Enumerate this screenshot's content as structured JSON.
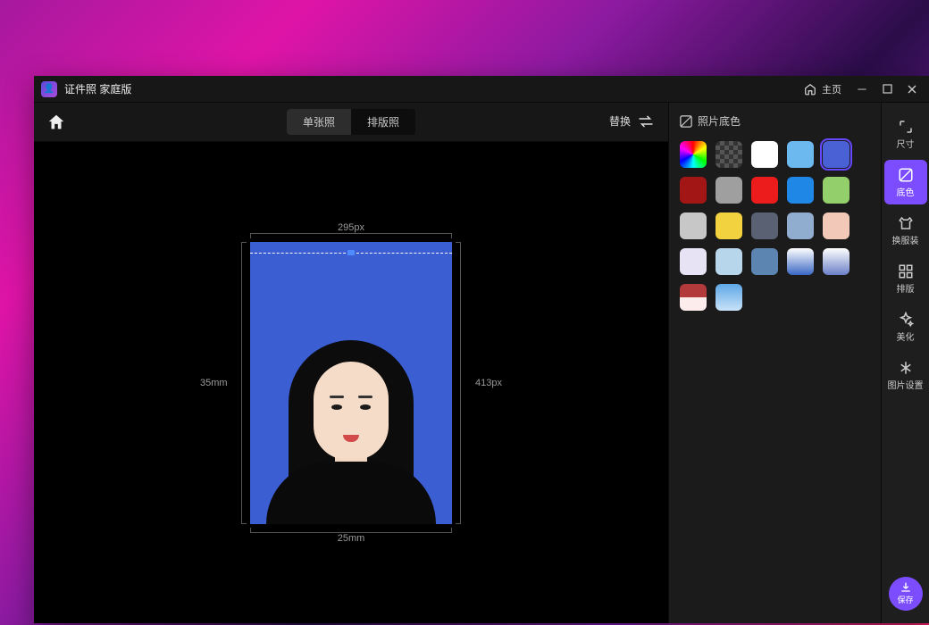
{
  "titlebar": {
    "app_name": "证件照 家庭版",
    "home_label": "主页"
  },
  "toolbar": {
    "tab_single": "单张照",
    "tab_layout": "排版照",
    "replace_label": "替换"
  },
  "canvas": {
    "width_px_label": "295px",
    "height_px_label": "413px",
    "width_mm_label": "25mm",
    "height_mm_label": "35mm",
    "photo_bg_color": "#3b5ed3"
  },
  "panel": {
    "title": "照片底色",
    "swatches": [
      {
        "type": "rainbow"
      },
      {
        "type": "transparent"
      },
      {
        "type": "solid",
        "color": "#ffffff"
      },
      {
        "type": "solid",
        "color": "#6bb9ee"
      },
      {
        "type": "solid",
        "color": "#4a61d6",
        "selected": true
      },
      {
        "type": "solid",
        "color": "#a31616"
      },
      {
        "type": "solid",
        "color": "#9f9f9f"
      },
      {
        "type": "solid",
        "color": "#ed1c1c"
      },
      {
        "type": "solid",
        "color": "#1f87e6"
      },
      {
        "type": "solid",
        "color": "#93cf6a"
      },
      {
        "type": "solid",
        "color": "#c7c7c7"
      },
      {
        "type": "solid",
        "color": "#f2d23e"
      },
      {
        "type": "solid",
        "color": "#596173"
      },
      {
        "type": "solid",
        "color": "#90accf"
      },
      {
        "type": "solid",
        "color": "#f2c8b8"
      },
      {
        "type": "solid",
        "color": "#e7e2f4"
      },
      {
        "type": "solid",
        "color": "#b7d6ec"
      },
      {
        "type": "solid",
        "color": "#5d85b1"
      },
      {
        "type": "grad-bw"
      },
      {
        "type": "grad-pb"
      },
      {
        "type": "grad-rb"
      },
      {
        "type": "grad-blue"
      }
    ]
  },
  "rail": {
    "items": [
      {
        "id": "size",
        "label": "尺寸"
      },
      {
        "id": "bgcolor",
        "label": "底色",
        "active": true
      },
      {
        "id": "clothes",
        "label": "换服装"
      },
      {
        "id": "layout",
        "label": "排版"
      },
      {
        "id": "beautify",
        "label": "美化"
      },
      {
        "id": "settings",
        "label": "图片设置"
      }
    ],
    "save_label": "保存"
  }
}
